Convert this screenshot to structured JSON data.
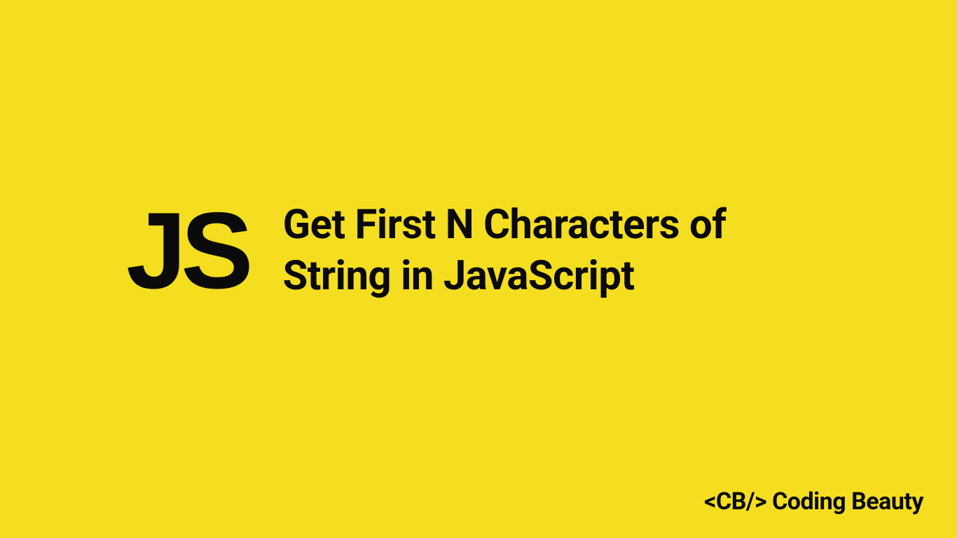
{
  "badge": {
    "text": "JS"
  },
  "headline": {
    "line1": "Get First N Characters of",
    "line2": "String in JavaScript"
  },
  "footer": {
    "brand": "<CB/> Coding Beauty"
  },
  "colors": {
    "background": "#F4DE1F",
    "text": "#0A0A0A"
  }
}
